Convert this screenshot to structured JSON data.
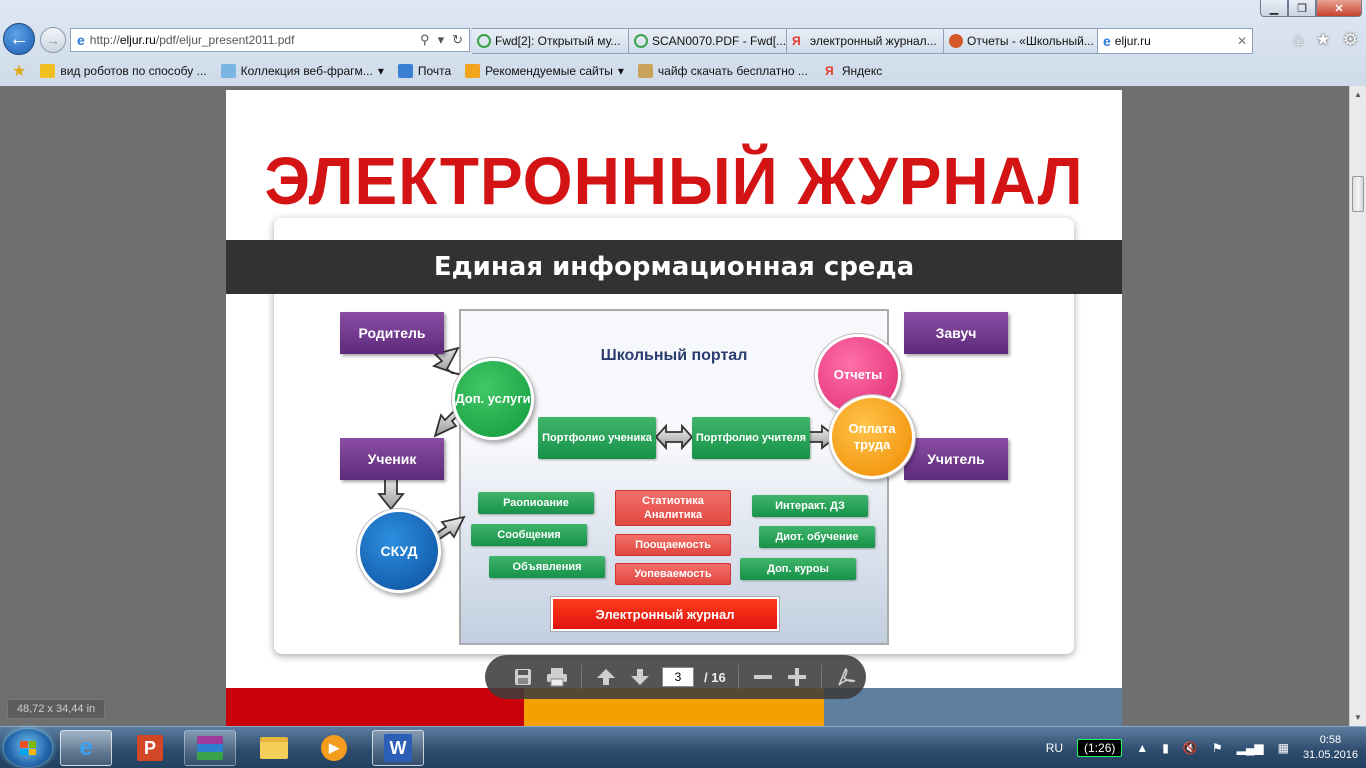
{
  "browser": {
    "url_prefix": "http://",
    "url_host": "eljur.ru",
    "url_path": "/pdf/eljur_present2011.pdf",
    "tabs": [
      {
        "label": "Fwd[2]: Открытый му...",
        "color": "#3aa24a"
      },
      {
        "label": "SCAN0070.PDF - Fwd[...",
        "color": "#3aa24a"
      },
      {
        "label": "электронный журнал...",
        "color": "#e23b2e"
      },
      {
        "label": "Отчеты - «Школьный...",
        "color": "#d4582a"
      },
      {
        "label": "eljur.ru",
        "color": "#2b7bd6",
        "active": true
      }
    ],
    "favorites": [
      {
        "label": "вид роботов по способу ...",
        "icon": "folder-image-icon"
      },
      {
        "label": "Коллекция веб-фрагм...",
        "icon": "web-slice-icon",
        "dropdown": true
      },
      {
        "label": "Почта",
        "icon": "mail-icon"
      },
      {
        "label": "Рекомендуемые сайты",
        "icon": "bing-icon",
        "dropdown": true
      },
      {
        "label": "чайф скачать бесплатно ...",
        "icon": "bookmark-icon"
      },
      {
        "label": "Яндекс",
        "icon": "yandex-icon"
      }
    ]
  },
  "slide": {
    "title": "ЭЛЕКТРОННЫЙ ЖУРНАЛ",
    "banner": "Единая информационная среда",
    "portal_title": "Школьный портал",
    "roles": {
      "parent": "Родитель",
      "student": "Ученик",
      "head_teacher": "Завуч",
      "teacher": "Учитель"
    },
    "circles": {
      "extra": "Доп. услуги",
      "skud": "СКУД",
      "reports": "Отчеты",
      "payment": "Оплата труда"
    },
    "portfolio_student": "Портфолио ученика",
    "portfolio_teacher": "Портфолио учителя",
    "green_left": [
      "Раопиоание",
      "Сообщения",
      "Объявления"
    ],
    "red_center": [
      "Статиотика Аналитика",
      "Поощаемость",
      "Уопеваемость"
    ],
    "green_right": [
      "Интеракт. ДЗ",
      "Диот. обучение",
      "Доп. куроы"
    ],
    "ej_button": "Электронный журнал"
  },
  "pdf_toolbar": {
    "current_page": "3",
    "separator": "/",
    "total_pages": "16"
  },
  "dimensions_readout": "48,72 x 34,44 in",
  "taskbar": {
    "language": "RU",
    "battery": "(1:26)",
    "time": "0:58",
    "date": "31.05.2016"
  }
}
